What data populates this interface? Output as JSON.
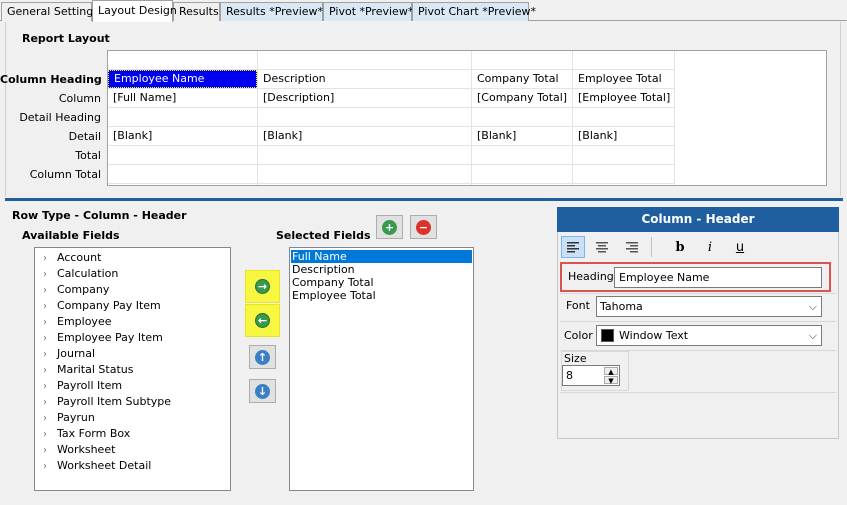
{
  "tabs": [
    {
      "label": "General Settings",
      "state": "normal"
    },
    {
      "label": "Layout Design",
      "state": "active"
    },
    {
      "label": "Results",
      "state": "normal"
    },
    {
      "label": "Results  *Preview*",
      "state": "preview"
    },
    {
      "label": "Pivot *Preview*",
      "state": "preview"
    },
    {
      "label": "Pivot Chart *Preview*",
      "state": "preview"
    }
  ],
  "report_layout": {
    "title": "Report Layout",
    "row_labels": [
      "Column Heading",
      "Column",
      "Detail Heading",
      "Detail",
      "Total",
      "Column Total"
    ],
    "grid": [
      [
        "Employee Name",
        "Description",
        "Company Total",
        "Employee Total"
      ],
      [
        "[Full Name]",
        "[Description]",
        "[Company Total]",
        "[Employee Total]"
      ],
      [
        "",
        "",
        "",
        ""
      ],
      [
        "[Blank]",
        "[Blank]",
        "[Blank]",
        "[Blank]"
      ],
      [
        "",
        "",
        "",
        ""
      ],
      [
        "",
        "",
        "",
        ""
      ]
    ]
  },
  "row_type": {
    "title": "Row Type - Column - Header",
    "available_label": "Available Fields",
    "selected_label": "Selected Fields",
    "available": [
      "Account",
      "Calculation",
      "Company",
      "Company Pay Item",
      "Employee",
      "Employee Pay Item",
      "Journal",
      "Marital Status",
      "Payroll Item",
      "Payroll Item Subtype",
      "Payrun",
      "Tax Form Box",
      "Worksheet",
      "Worksheet Detail"
    ],
    "selected": [
      "Full Name",
      "Description",
      "Company Total",
      "Employee Total"
    ],
    "selected_index": 0
  },
  "format_panel": {
    "title": "Column - Header",
    "heading_label": "Heading",
    "heading_value": "Employee Name",
    "font_label": "Font",
    "font_value": "Tahoma",
    "color_label": "Color",
    "color_value": "Window Text",
    "color_swatch": "#000000",
    "size_label": "Size",
    "size_value": "8"
  },
  "colors": {
    "accent": "#1f5f9f",
    "selection": "#0000f0",
    "highlight": "#f7f741",
    "add_green": "#3a9a4c",
    "remove_red": "#d9332c",
    "red_outline": "#d9534f"
  },
  "icons": {
    "add": "plus-circle-icon",
    "remove": "minus-circle-icon",
    "move_right": "arrow-right-circle-icon",
    "move_left": "arrow-left-circle-icon",
    "move_up": "arrow-up-circle-icon",
    "move_down": "arrow-down-circle-icon"
  }
}
